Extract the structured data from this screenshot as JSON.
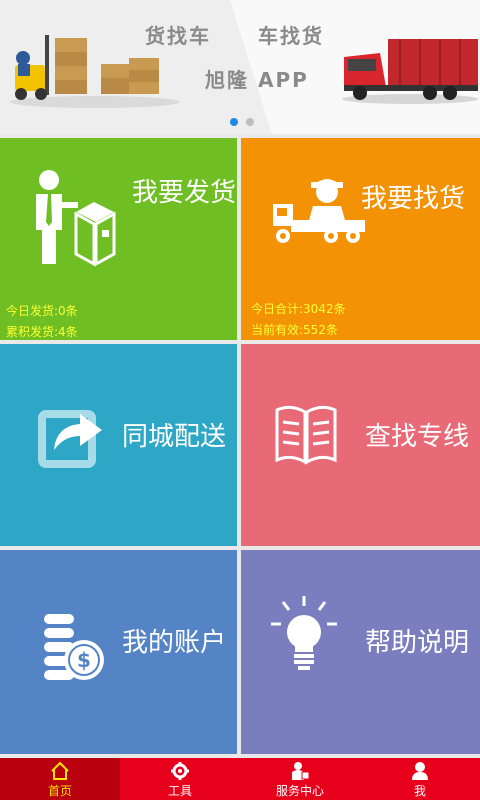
{
  "banner": {
    "line1_left": "货找车",
    "line1_right": "车找货",
    "line2": "旭隆  APP",
    "slides": 2,
    "active_slide": 1
  },
  "tiles": {
    "send_goods": {
      "title": "我要发货",
      "stat1": "今日发货:0条",
      "stat2": "累积发货:4条",
      "color": "#6fbf24"
    },
    "find_goods": {
      "title": "我要找货",
      "stat1": "今日合计:3042条",
      "stat2": "当前有效:552条",
      "color": "#f39204"
    },
    "city_delivery": {
      "title": "同城配送",
      "color": "#2ea7c6"
    },
    "find_line": {
      "title": "查找专线",
      "color": "#e96a77"
    },
    "my_account": {
      "title": "我的账户",
      "color": "#5484c5"
    },
    "help": {
      "title": "帮助说明",
      "color": "#7a7ebf"
    }
  },
  "tabbar": {
    "items": [
      {
        "label": "首页",
        "icon": "home-icon",
        "active": true
      },
      {
        "label": "工具",
        "icon": "gear-icon",
        "active": false
      },
      {
        "label": "服务中心",
        "icon": "service-person-icon",
        "active": false
      },
      {
        "label": "我",
        "icon": "user-icon",
        "active": false
      }
    ]
  }
}
